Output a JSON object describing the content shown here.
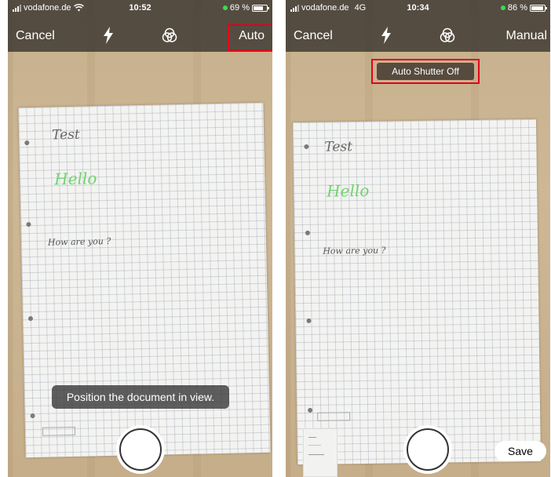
{
  "left": {
    "status": {
      "carrier": "vodafone.de",
      "time": "10:52",
      "battery": "69 %",
      "battery_level": 0.69
    },
    "toolbar": {
      "cancel_label": "Cancel",
      "mode_label": "Auto",
      "flash_icon": "flash-icon",
      "filter_icon": "filter-icon"
    },
    "document": {
      "line1": "Test",
      "line2": "Hello",
      "line3": "How are you ?"
    },
    "hint": "Position the document in view.",
    "shutter_icon": "shutter-button"
  },
  "right": {
    "status": {
      "carrier": "vodafone.de",
      "network": "4G",
      "time": "10:34",
      "battery": "86 %",
      "battery_level": 0.86
    },
    "toolbar": {
      "cancel_label": "Cancel",
      "mode_label": "Manual",
      "flash_icon": "flash-icon",
      "filter_icon": "filter-icon"
    },
    "badge": "Auto Shutter Off",
    "document": {
      "line1": "Test",
      "line2": "Hello",
      "line3": "How are you ?"
    },
    "save_label": "Save",
    "shutter_icon": "shutter-button"
  },
  "colors": {
    "highlight": "#e3001b",
    "battery_dot": "#3ddc4c",
    "hello_ink": "#6fd36f"
  }
}
